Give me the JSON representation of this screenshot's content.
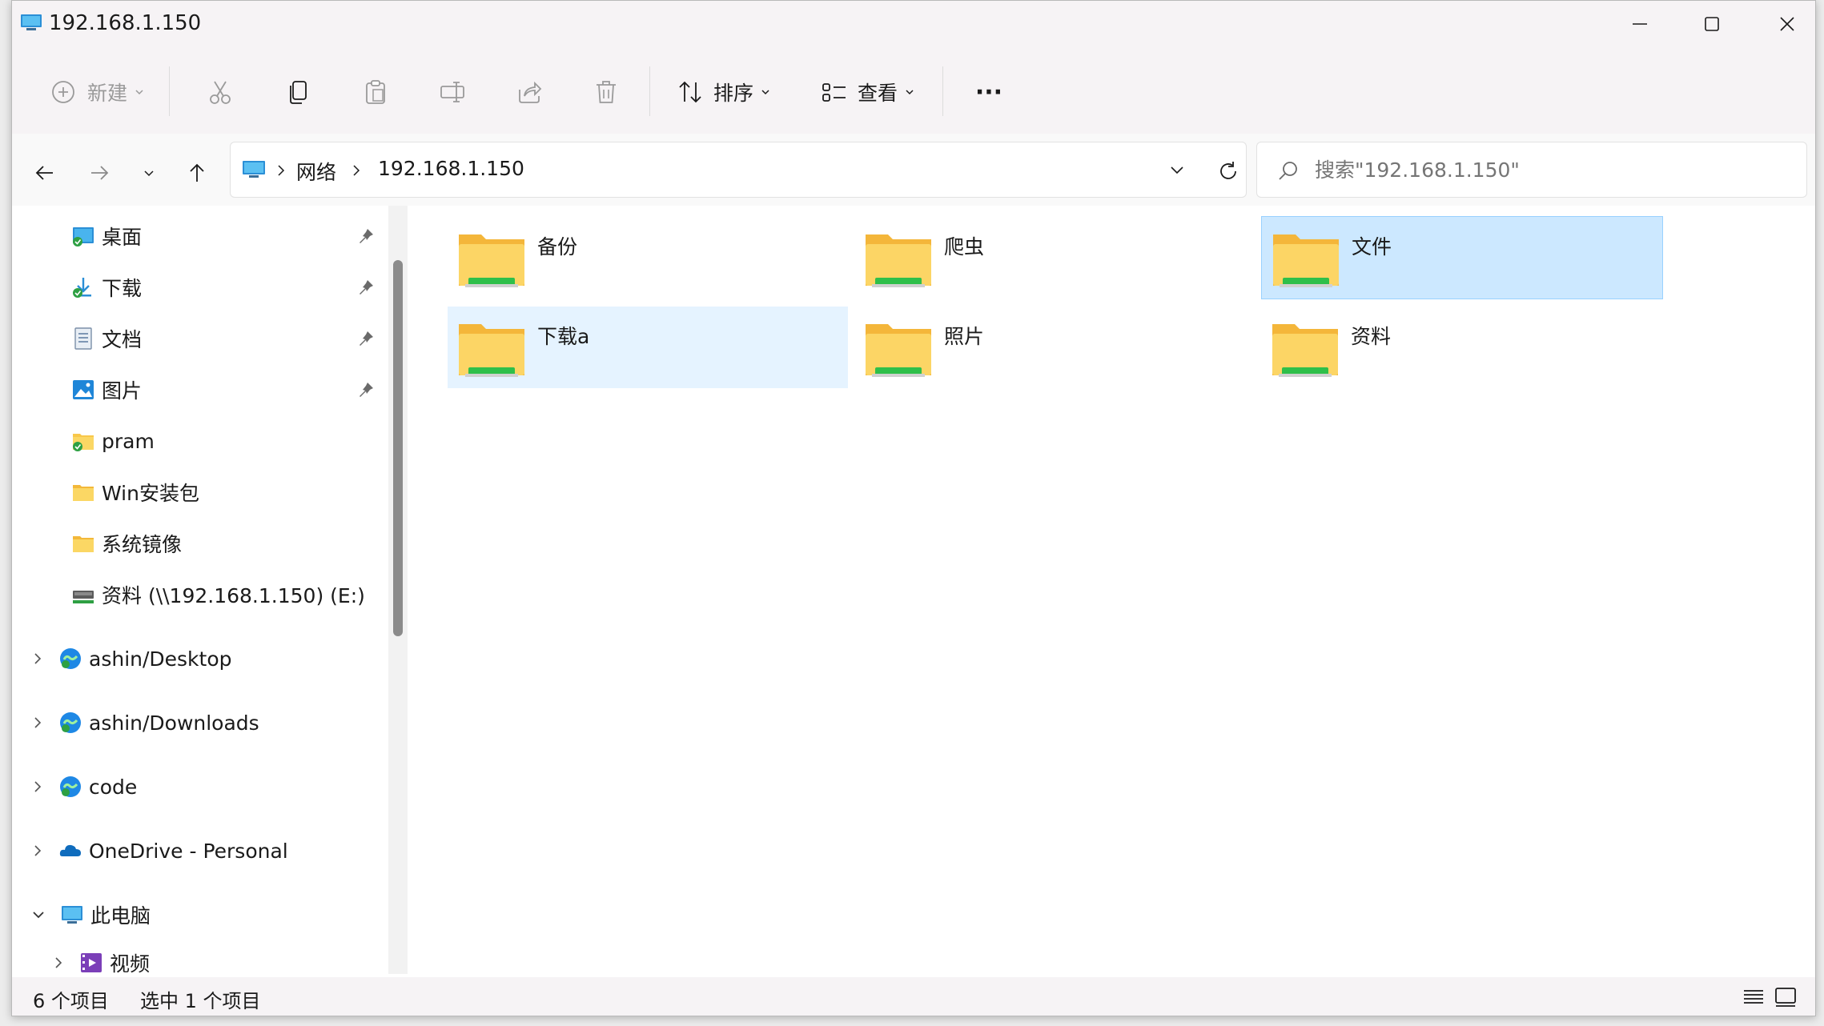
{
  "window": {
    "title": "192.168.1.150"
  },
  "toolbar": {
    "new_label": "新建",
    "sort_label": "排序",
    "view_label": "查看",
    "more_label": "···"
  },
  "address": {
    "segments": [
      "网络",
      "192.168.1.150"
    ]
  },
  "search": {
    "placeholder": "搜索\"192.168.1.150\""
  },
  "sidebar": {
    "quick": [
      {
        "label": "桌面",
        "icon": "desktop-icon",
        "pinned": true
      },
      {
        "label": "下载",
        "icon": "download-icon",
        "pinned": true
      },
      {
        "label": "文档",
        "icon": "document-icon",
        "pinned": true
      },
      {
        "label": "图片",
        "icon": "picture-icon",
        "pinned": true
      },
      {
        "label": "pram",
        "icon": "folder-synced-icon",
        "pinned": false
      },
      {
        "label": "Win安装包",
        "icon": "folder-icon",
        "pinned": false
      },
      {
        "label": "系统镜像",
        "icon": "folder-icon",
        "pinned": false
      },
      {
        "label": "资料 (\\\\192.168.1.150) (E:)",
        "icon": "network-drive-icon",
        "pinned": false
      }
    ],
    "tree": [
      {
        "label": "ashin/Desktop",
        "icon": "sync-cloud-icon",
        "expanded": false
      },
      {
        "label": "ashin/Downloads",
        "icon": "sync-cloud-icon",
        "expanded": false
      },
      {
        "label": "code",
        "icon": "sync-cloud-icon",
        "expanded": false
      },
      {
        "label": "OneDrive - Personal",
        "icon": "onedrive-icon",
        "expanded": false
      },
      {
        "label": "此电脑",
        "icon": "computer-icon",
        "expanded": true
      },
      {
        "label": "视频",
        "icon": "video-icon",
        "expanded": false
      }
    ]
  },
  "files": [
    {
      "name": "备份",
      "state": "normal"
    },
    {
      "name": "爬虫",
      "state": "normal"
    },
    {
      "name": "文件",
      "state": "selected"
    },
    {
      "name": "下载a",
      "state": "hover"
    },
    {
      "name": "照片",
      "state": "normal"
    },
    {
      "name": "资料",
      "state": "normal"
    }
  ],
  "status": {
    "count": "6 个项目",
    "selected": "选中 1 个项目"
  },
  "colors": {
    "accent": "#0067c0",
    "selection": "#cce8ff",
    "hover": "#e5f3ff",
    "folder": "#f8c74a"
  }
}
